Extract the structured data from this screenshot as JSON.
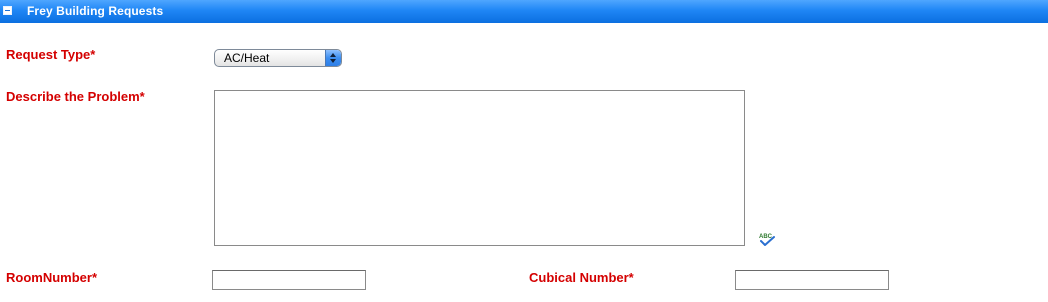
{
  "section": {
    "title": "Frey Building Requests",
    "header_color": "#1f86f5"
  },
  "form": {
    "request_type": {
      "label": "Request Type*",
      "selected": "AC/Heat"
    },
    "problem": {
      "label": "Describe the Problem*",
      "value": ""
    },
    "spellcheck": {
      "icon": "spellcheck-abc-icon",
      "text": "ABC"
    },
    "room_number": {
      "label": "RoomNumber*",
      "value": ""
    },
    "cubical_number": {
      "label": "Cubical Number*",
      "value": ""
    },
    "label_color": "#d40000"
  }
}
